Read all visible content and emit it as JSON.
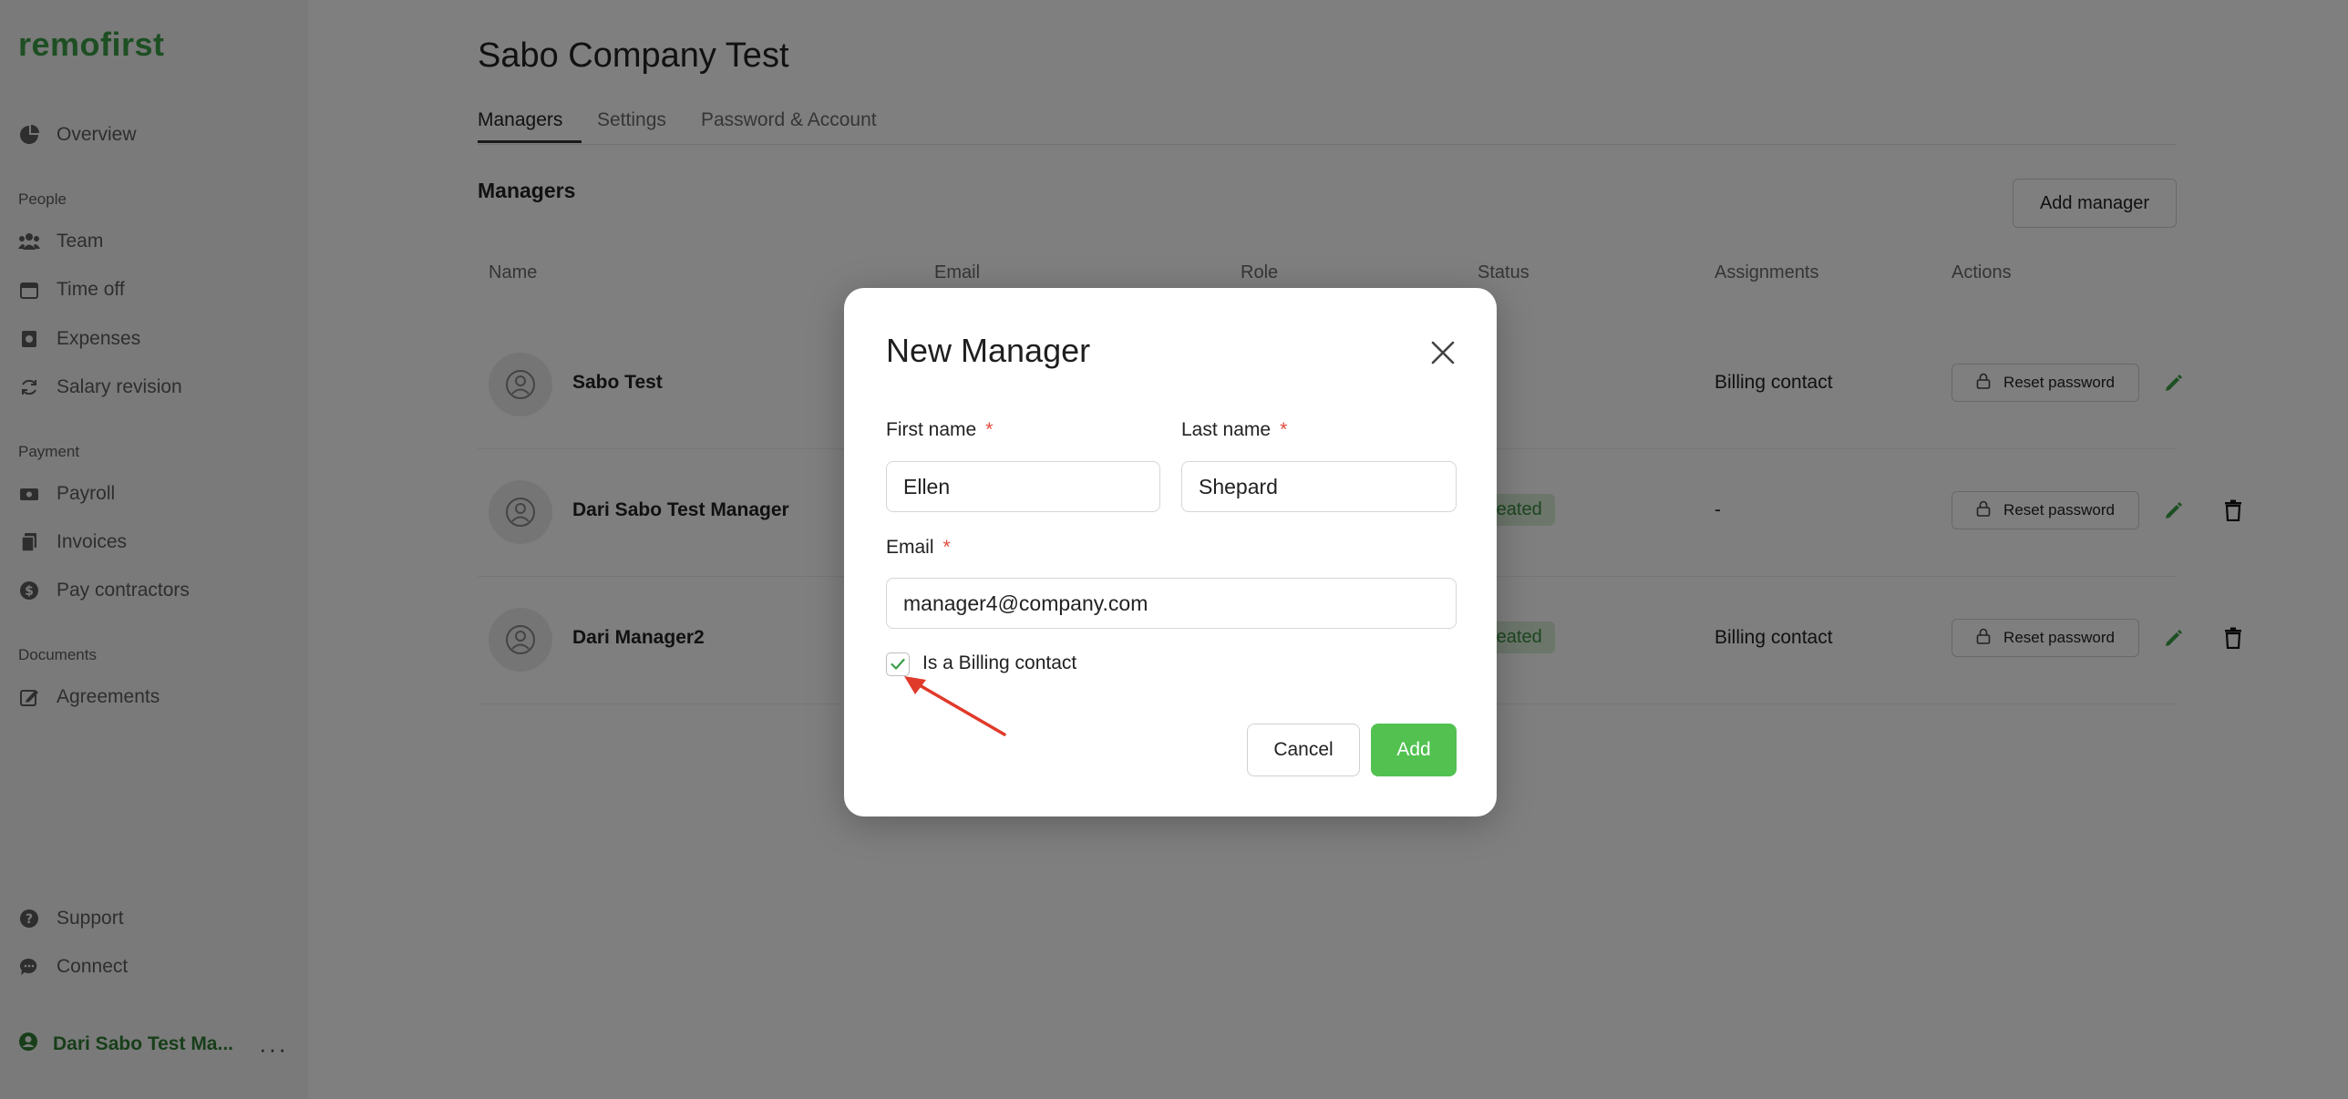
{
  "app": {
    "logo": "remofirst"
  },
  "sidebar": {
    "overview": "Overview",
    "sections": {
      "people": "People",
      "payment": "Payment",
      "documents": "Documents"
    },
    "people_items": [
      "Team",
      "Time off",
      "Expenses",
      "Salary revision"
    ],
    "payment_items": [
      "Payroll",
      "Invoices",
      "Pay contractors"
    ],
    "document_items": [
      "Agreements"
    ],
    "bottom_items": [
      "Support",
      "Connect"
    ],
    "user_name": "Dari Sabo Test Ma...",
    "more_label": "···"
  },
  "page": {
    "title": "Sabo Company Test",
    "tabs": [
      "Managers",
      "Settings",
      "Password & Account"
    ],
    "section_title": "Managers",
    "add_manager_label": "Add manager"
  },
  "table": {
    "columns": [
      "Name",
      "Email",
      "Role",
      "Status",
      "Assignments",
      "Actions"
    ],
    "rows": [
      {
        "name": "Sabo Test",
        "status": "",
        "assignments": "Billing contact",
        "reset_label": "Reset password"
      },
      {
        "name": "Dari Sabo Test Manager",
        "status": "reated",
        "assignments": "-",
        "reset_label": "Reset password"
      },
      {
        "name": "Dari Manager2",
        "status": "reated",
        "assignments": "Billing contact",
        "reset_label": "Reset password"
      }
    ]
  },
  "modal": {
    "title": "New Manager",
    "first_name_label": "First name",
    "first_name_value": "Ellen",
    "last_name_label": "Last name",
    "last_name_value": "Shepard",
    "email_label": "Email",
    "email_value": "manager4@company.com",
    "required_mark": "*",
    "billing_checkbox_label": "Is a Billing contact",
    "billing_checked": true,
    "cancel_label": "Cancel",
    "add_label": "Add"
  },
  "colors": {
    "brand": "#3b9e47",
    "add_button": "#52c150",
    "required": "#e24b3b",
    "annotation_arrow": "#e03a2a"
  }
}
